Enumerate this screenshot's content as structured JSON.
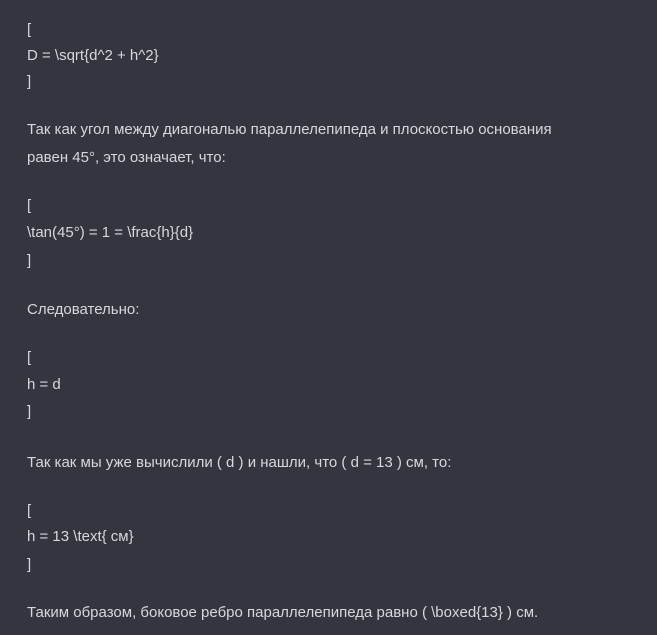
{
  "message": {
    "block1": {
      "open": "[",
      "formula": "D = \\sqrt{d^2 + h^2}",
      "close": "]"
    },
    "paragraph1": {
      "line1": "Так как угол между диагональю параллелепипеда и плоскостью основания",
      "line2": "равен 45°, это означает, что:"
    },
    "block2": {
      "open": "[",
      "formula": "\\tan(45°) = 1 = \\frac{h}{d}",
      "close": "]"
    },
    "paragraph2": "Следовательно:",
    "block3": {
      "open": "[",
      "formula": "h = d",
      "close": "]"
    },
    "paragraph3": "Так как мы уже вычислили ( d ) и нашли, что ( d = 13 ) см, то:",
    "block4": {
      "open": "[",
      "formula": "h = 13 \\text{ см}",
      "close": "]"
    },
    "paragraph4": "Таким образом, боковое ребро параллелепипеда равно ( \\boxed{13} ) см."
  }
}
